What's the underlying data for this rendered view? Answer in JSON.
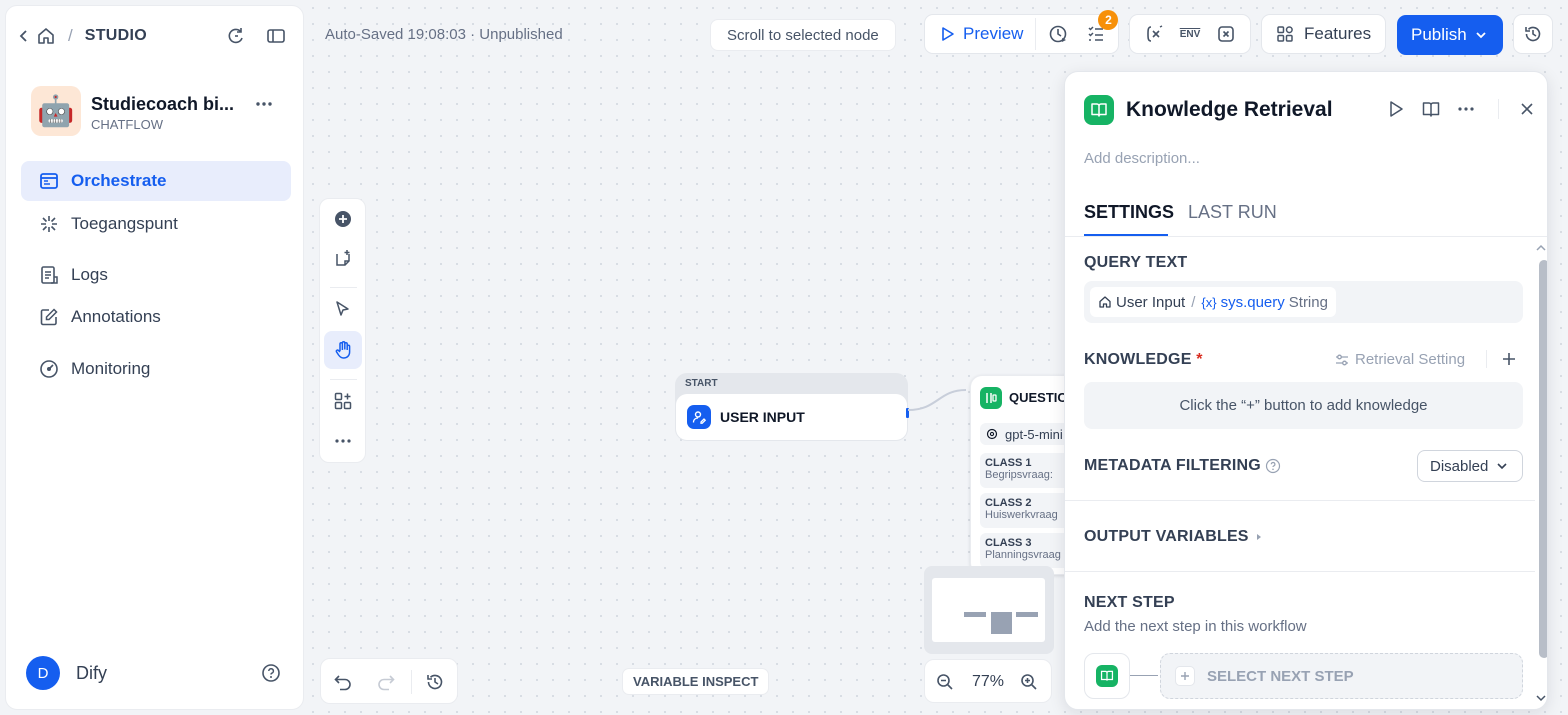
{
  "sidebar": {
    "breadcrumb_title": "STUDIO",
    "app": {
      "name": "Studiecoach bi...",
      "type": "CHATFLOW",
      "avatar_emoji": "🤖"
    },
    "nav": [
      {
        "label": "Orchestrate",
        "icon": "window-icon"
      },
      {
        "label": "Toegangspunt",
        "icon": "burst-icon"
      },
      {
        "label": "Logs",
        "icon": "document-list-icon"
      },
      {
        "label": "Annotations",
        "icon": "edit-note-icon"
      },
      {
        "label": "Monitoring",
        "icon": "gauge-icon"
      }
    ],
    "user": {
      "initial": "D",
      "name": "Dify"
    }
  },
  "header": {
    "autosave": "Auto-Saved 19:08:03 · Unpublished",
    "scroll_btn": "Scroll to selected node",
    "preview": "Preview",
    "checklist_badge": "2",
    "env_label": "ENV",
    "features": "Features",
    "publish": "Publish"
  },
  "canvas": {
    "start_node": {
      "tag": "START",
      "title": "USER INPUT"
    },
    "classifier": {
      "title": "QUESTIO",
      "model": "gpt-5-mini",
      "classes": [
        {
          "name": "CLASS 1",
          "text": "Begripsvraag: "
        },
        {
          "name": "CLASS 2",
          "text": "Huiswerkvraag"
        },
        {
          "name": "CLASS 3",
          "text": "Planningsvraag"
        }
      ]
    },
    "variable_inspect": "VARIABLE INSPECT",
    "zoom": "77%"
  },
  "panel": {
    "title": "Knowledge Retrieval",
    "description_placeholder": "Add description...",
    "tabs": [
      "SETTINGS",
      "LAST RUN"
    ],
    "query_text": {
      "label": "QUERY TEXT",
      "node": "User Input",
      "sep": "/",
      "var": "sys.query",
      "type": "String"
    },
    "knowledge": {
      "label": "KNOWLEDGE",
      "required": "*",
      "retrieval_setting": "Retrieval Setting",
      "empty": "Click the “+” button to add knowledge"
    },
    "metadata": {
      "label": "METADATA FILTERING",
      "value": "Disabled"
    },
    "output": {
      "label": "OUTPUT VARIABLES"
    },
    "next_step": {
      "label": "NEXT STEP",
      "desc": "Add the next step in this workflow",
      "select": "SELECT NEXT STEP"
    }
  },
  "colors": {
    "accent": "#155eef",
    "knowledge_green": "#16b364",
    "badge_orange": "#f79009"
  }
}
